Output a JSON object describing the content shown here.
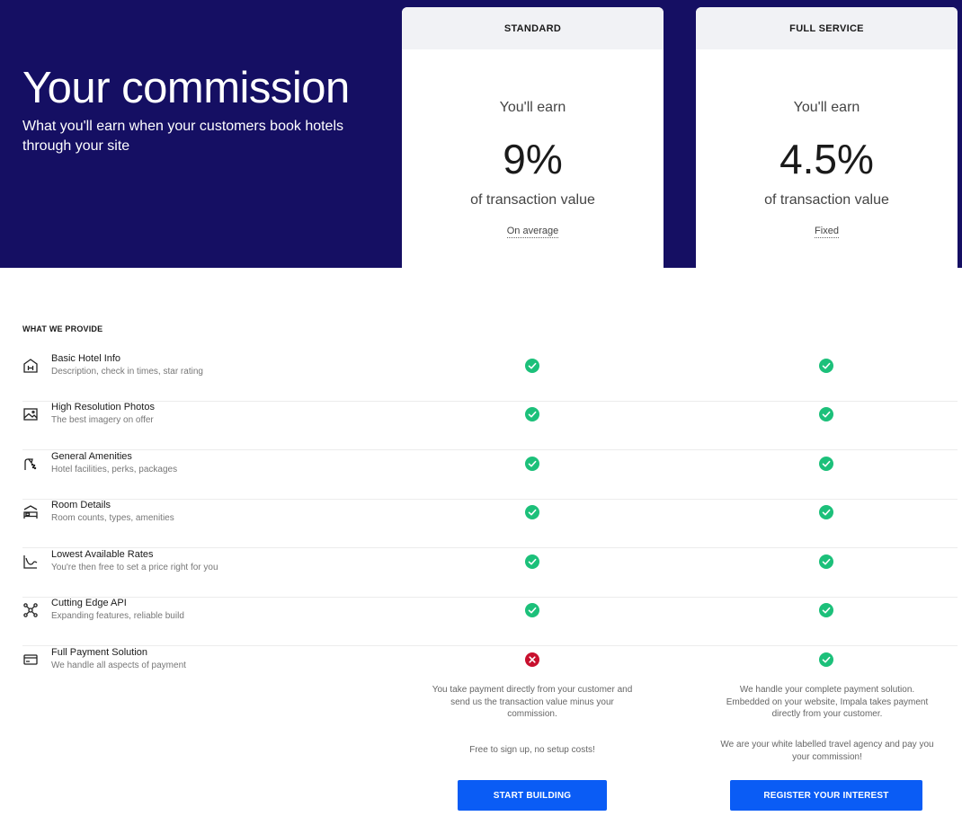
{
  "hero": {
    "title": "Your commission",
    "subtitle": "What you'll earn when your customers book hotels through your site"
  },
  "plans": [
    {
      "name": "STANDARD",
      "earn_label": "You'll earn",
      "rate": "9%",
      "rate_sub": "of transaction value",
      "note": "On average"
    },
    {
      "name": "FULL SERVICE",
      "earn_label": "You'll earn",
      "rate": "4.5%",
      "rate_sub": "of transaction value",
      "note": "Fixed"
    }
  ],
  "section_title": "WHAT WE PROVIDE",
  "features": [
    {
      "name": "Basic Hotel Info",
      "desc": "Description, check in times, star rating",
      "icon": "hotel-icon",
      "standard": true,
      "full_service": true
    },
    {
      "name": "High Resolution Photos",
      "desc": "The best imagery on offer",
      "icon": "photo-icon",
      "standard": true,
      "full_service": true
    },
    {
      "name": "General Amenities",
      "desc": "Hotel facilities, perks, packages",
      "icon": "shower-icon",
      "standard": true,
      "full_service": true
    },
    {
      "name": "Room Details",
      "desc": "Room counts, types, amenities",
      "icon": "bed-icon",
      "standard": true,
      "full_service": true
    },
    {
      "name": "Lowest Available Rates",
      "desc": "You're then free to set a price right for you",
      "icon": "rate-chart-icon",
      "standard": true,
      "full_service": true
    },
    {
      "name": "Cutting Edge API",
      "desc": "Expanding features, reliable build",
      "icon": "api-network-icon",
      "standard": true,
      "full_service": true
    },
    {
      "name": "Full Payment Solution",
      "desc": "We handle all aspects of payment",
      "icon": "credit-card-icon",
      "standard": false,
      "full_service": true
    }
  ],
  "standard_details": {
    "payment_text": "You take payment directly from your customer and send us the transaction value minus your commission.",
    "signup_text": "Free to sign up, no setup costs!",
    "cta": "START BUILDING"
  },
  "full_service_details": {
    "payment_text": "We handle your complete payment solution. Embedded on your website, Impala takes payment directly from your customer.",
    "agency_text": "We are your white labelled travel agency and pay you your commission!",
    "cta": "REGISTER YOUR INTEREST"
  },
  "colors": {
    "hero_bg": "#150f63",
    "check": "#1cc07a",
    "cross": "#c8102e",
    "cta": "#0a5cf5"
  }
}
